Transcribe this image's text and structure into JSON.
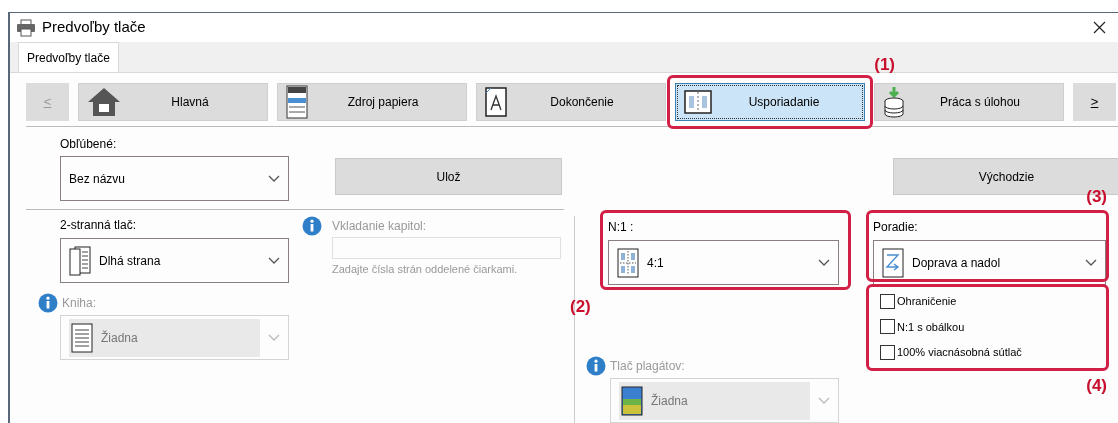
{
  "window": {
    "title": "Predvoľby tlače"
  },
  "tab": {
    "label": "Predvoľby tlače"
  },
  "nav": {
    "prev": {
      "label": "<",
      "disabled": true
    },
    "next": {
      "label": ">",
      "disabled": false
    },
    "items": [
      {
        "label": "Hlavná",
        "kind": "home",
        "selected": false
      },
      {
        "label": "Zdroj papiera",
        "kind": "paper",
        "selected": false
      },
      {
        "label": "Dokončenie",
        "kind": "finishing",
        "selected": false
      },
      {
        "label": "Usporiadanie",
        "kind": "layout",
        "selected": true,
        "callout": "(1)"
      },
      {
        "label": "Práca s úlohou",
        "kind": "job",
        "selected": false
      }
    ]
  },
  "favorites": {
    "label": "Obľúbené:",
    "value": "Bez názvu"
  },
  "save_button": "Ulož",
  "default_button": "Východzie",
  "duplex": {
    "label": "2-stranná tlač:",
    "value": "Dlhá strana"
  },
  "book": {
    "label": "Kniha:",
    "value": "Žiadna",
    "disabled": true
  },
  "chapter_insert": {
    "label": "Vkladanie kapitol:",
    "hint": "Zadajte čísla strán oddelené čiarkami.",
    "disabled": true
  },
  "n_up": {
    "label": "N:1 :",
    "value": "4:1",
    "callout": "(2)"
  },
  "poster": {
    "label": "Tlač plagátov:",
    "value": "Žiadna",
    "disabled": true
  },
  "order": {
    "label": "Poradie:",
    "value": "Doprava a nadol",
    "callout": "(3)"
  },
  "options": {
    "callout": "(4)",
    "checkboxes": [
      {
        "label": "Ohraničenie",
        "checked": false
      },
      {
        "label": "N:1 s obálkou",
        "checked": false
      },
      {
        "label": "100% viacnásobná sútlač",
        "checked": false
      }
    ]
  }
}
